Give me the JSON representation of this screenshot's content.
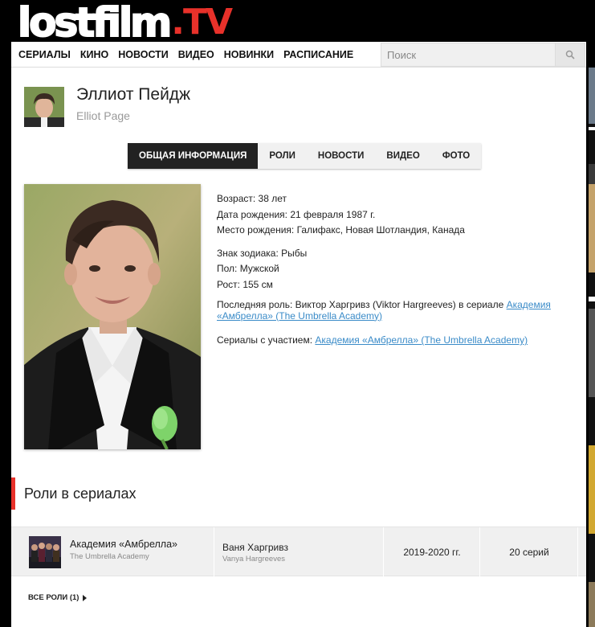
{
  "site": {
    "logo_main": "lostfilm",
    "logo_tv": ".TV"
  },
  "nav": {
    "items": [
      "Сериалы",
      "Кино",
      "Новости",
      "Видео",
      "Новинки",
      "Расписание"
    ],
    "search_placeholder": "Поиск"
  },
  "person": {
    "name": "Эллиот Пейдж",
    "original_name": "Elliot Page"
  },
  "tabs": [
    {
      "label": "Общая информация",
      "active": true
    },
    {
      "label": "Роли",
      "active": false
    },
    {
      "label": "Новости",
      "active": false
    },
    {
      "label": "Видео",
      "active": false
    },
    {
      "label": "Фото",
      "active": false
    }
  ],
  "info": {
    "age": "Возраст: 38 лет",
    "birth_date": "Дата рождения: 21 февраля 1987 г.",
    "birth_place": "Место рождения: Галифакс, Новая Шотландия, Канада",
    "zodiac": "Знак зодиака: Рыбы",
    "gender": "Пол: Мужской",
    "height": "Рост: 155 см",
    "last_role_prefix": "Последняя роль: Виктор Харгривз (Viktor Hargreeves) в сериале ",
    "last_role_link_line1": "Академия",
    "last_role_link_line2": "«Амбрелла» (The Umbrella Academy)",
    "series_prefix": "Сериалы с участием: ",
    "series_link": "Академия «Амбрелла» (The Umbrella Academy)"
  },
  "roles_section": {
    "title": "Роли в сериалах",
    "rows": [
      {
        "series": "Академия «Амбрелла»",
        "series_original": "The Umbrella Academy",
        "character": "Ваня Харгривз",
        "character_original": "Vanya Hargreeves",
        "years": "2019-2020 гг.",
        "episodes": "20 серий"
      }
    ],
    "all_roles_label": "Все роли (1)"
  },
  "colors": {
    "accent": "#e8312a",
    "link": "#3a8bc8"
  }
}
